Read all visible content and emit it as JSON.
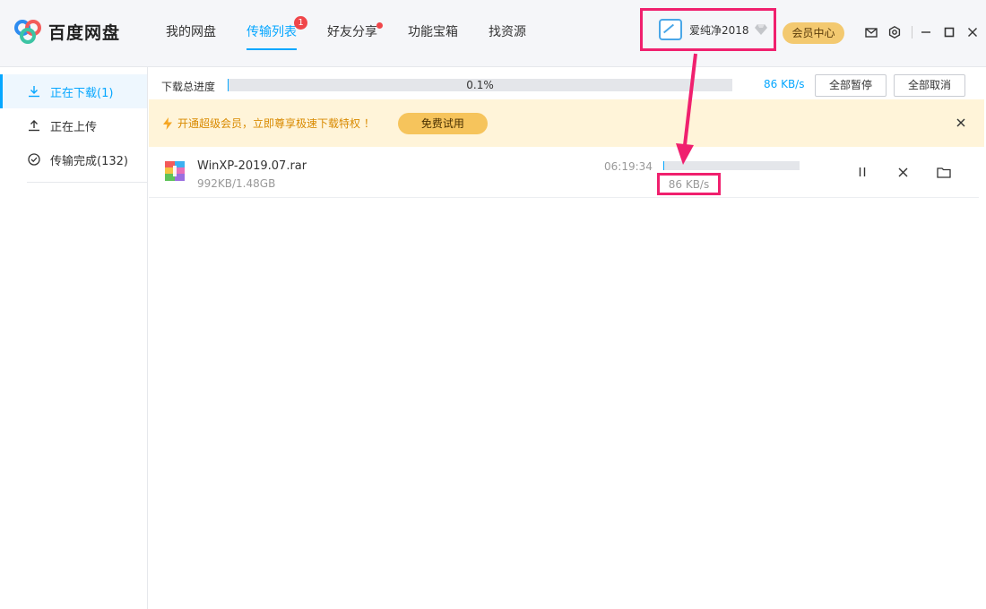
{
  "app": {
    "name": "百度网盘"
  },
  "nav": {
    "items": [
      {
        "label": "我的网盘"
      },
      {
        "label": "传输列表",
        "badge": "1"
      },
      {
        "label": "好友分享"
      },
      {
        "label": "功能宝箱"
      },
      {
        "label": "找资源"
      }
    ]
  },
  "user": {
    "name": "爱纯净2018",
    "vip_label": "会员中心"
  },
  "sidebar": {
    "items": [
      {
        "label": "正在下载(1)",
        "icon": "download-icon"
      },
      {
        "label": "正在上传",
        "icon": "upload-icon"
      },
      {
        "label": "传输完成(132)",
        "icon": "check-circle-icon"
      }
    ]
  },
  "transfer": {
    "progress_label": "下载总进度",
    "progress_percent": "0.1%",
    "progress_value": 0.001,
    "speed": "86 KB/s",
    "pause_all_label": "全部暂停",
    "cancel_all_label": "全部取消"
  },
  "banner": {
    "text": "开通超级会员，立即尊享极速下载特权 ！",
    "trial_label": "免费试用"
  },
  "files": [
    {
      "name": "WinXP-2019.07.rar",
      "size": "992KB/1.48GB",
      "time_left": "06:19:34",
      "speed": "86 KB/s",
      "progress": 0.001
    }
  ],
  "colors": {
    "accent": "#06a7ff",
    "highlight": "#f0206e",
    "vip": "#f3c970"
  }
}
